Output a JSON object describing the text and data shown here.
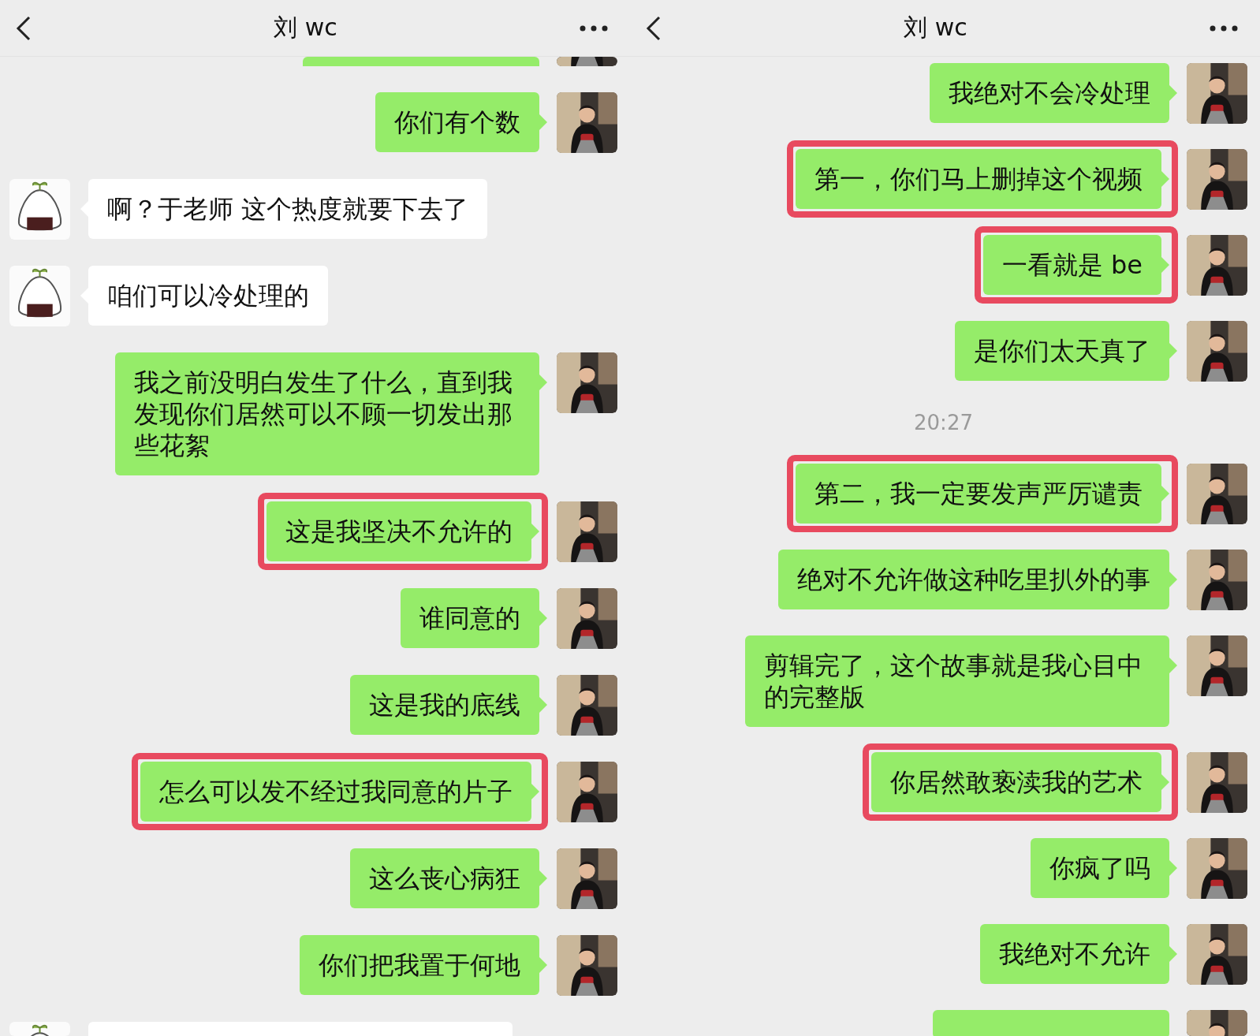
{
  "panels": [
    {
      "title": "刘 wc",
      "messages": [
        {
          "kind": "outgoing_cut"
        },
        {
          "kind": "outgoing",
          "text": "你们有个数",
          "highlighted": false
        },
        {
          "kind": "incoming",
          "text": "啊？于老师 这个热度就要下去了",
          "highlighted": false
        },
        {
          "kind": "incoming",
          "text": "咱们可以冷处理的",
          "highlighted": false
        },
        {
          "kind": "outgoing",
          "text": "我之前没明白发生了什么，直到我发现你们居然可以不顾一切发出那些花絮",
          "highlighted": false
        },
        {
          "kind": "outgoing",
          "text": "这是我坚决不允许的",
          "highlighted": true
        },
        {
          "kind": "outgoing",
          "text": "谁同意的",
          "highlighted": false
        },
        {
          "kind": "outgoing",
          "text": "这是我的底线",
          "highlighted": false
        },
        {
          "kind": "outgoing",
          "text": "怎么可以发不经过我同意的片子",
          "highlighted": true
        },
        {
          "kind": "outgoing",
          "text": "这么丧心病狂",
          "highlighted": false
        },
        {
          "kind": "outgoing",
          "text": "你们把我置于何地",
          "highlighted": false
        },
        {
          "kind": "incoming_cut"
        }
      ]
    },
    {
      "title": "刘 wc",
      "messages": [
        {
          "kind": "outgoing",
          "text": "我绝对不会冷处理",
          "highlighted": false
        },
        {
          "kind": "outgoing",
          "text": "第一，你们马上删掉这个视频",
          "highlighted": true
        },
        {
          "kind": "outgoing",
          "text": "一看就是 be",
          "highlighted": true
        },
        {
          "kind": "outgoing",
          "text": "是你们太天真了",
          "highlighted": false
        },
        {
          "kind": "time",
          "text": "20:27"
        },
        {
          "kind": "outgoing",
          "text": "第二，我一定要发声严厉谴责",
          "highlighted": true
        },
        {
          "kind": "outgoing",
          "text": "绝对不允许做这种吃里扒外的事",
          "highlighted": false
        },
        {
          "kind": "outgoing",
          "text": "剪辑完了，这个故事就是我心目中的完整版",
          "highlighted": false
        },
        {
          "kind": "outgoing",
          "text": "你居然敢亵渎我的艺术",
          "highlighted": true
        },
        {
          "kind": "outgoing",
          "text": "你疯了吗",
          "highlighted": false
        },
        {
          "kind": "outgoing",
          "text": "我绝对不允许",
          "highlighted": false
        },
        {
          "kind": "outgoing_cut"
        }
      ]
    }
  ]
}
